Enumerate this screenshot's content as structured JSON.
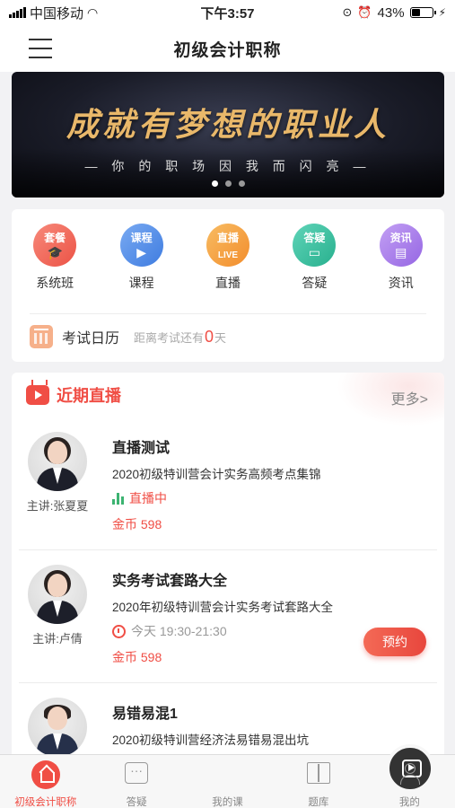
{
  "status_bar": {
    "carrier": "中国移动",
    "time": "下午3:57",
    "battery": "43%"
  },
  "nav": {
    "title": "初级会计职称"
  },
  "banner": {
    "title": "成就有梦想的职业人",
    "subtitle": "— 你 的 职 场 因 我 而 闪 亮 —",
    "slides": 3,
    "active_slide": 1
  },
  "categories": [
    {
      "icon_text": "套餐",
      "label": "系统班",
      "color": "#f16a5a",
      "icon": "graduation-cap-icon"
    },
    {
      "icon_text": "课程",
      "label": "课程",
      "color": "#4c8be8",
      "icon": "video-icon"
    },
    {
      "icon_text": "直播",
      "label": "直播",
      "color": "#f5a03c",
      "icon": "live-icon"
    },
    {
      "icon_text": "答疑",
      "label": "答疑",
      "color": "#35bfa0",
      "icon": "chat-icon"
    },
    {
      "icon_text": "资讯",
      "label": "资讯",
      "color": "#a67be8",
      "icon": "news-icon"
    }
  ],
  "exam_calendar": {
    "title": "考试日历",
    "prefix": "距离考试还有",
    "days": "0",
    "unit": "天"
  },
  "live_section": {
    "title": "近期直播",
    "more": "更多>",
    "courses": [
      {
        "title": "直播测试",
        "desc": "2020初级特训营会计实务高频考点集锦",
        "status": "直播中",
        "coin": "金币 598",
        "lecturer": "主讲:张夏夏"
      },
      {
        "title": "实务考试套路大全",
        "desc": "2020年初级特训营会计实务考试套路大全",
        "status": "今天 19:30-21:30",
        "coin": "金币 598",
        "lecturer": "主讲:卢倩",
        "button": "预约"
      },
      {
        "title": "易错易混1",
        "desc": "2020初级特训营经济法易错易混出坑",
        "lecturer": ""
      }
    ]
  },
  "tabbar": {
    "items": [
      "初级会计职称",
      "答疑",
      "我的课",
      "题库",
      "我的"
    ],
    "active": 0
  }
}
